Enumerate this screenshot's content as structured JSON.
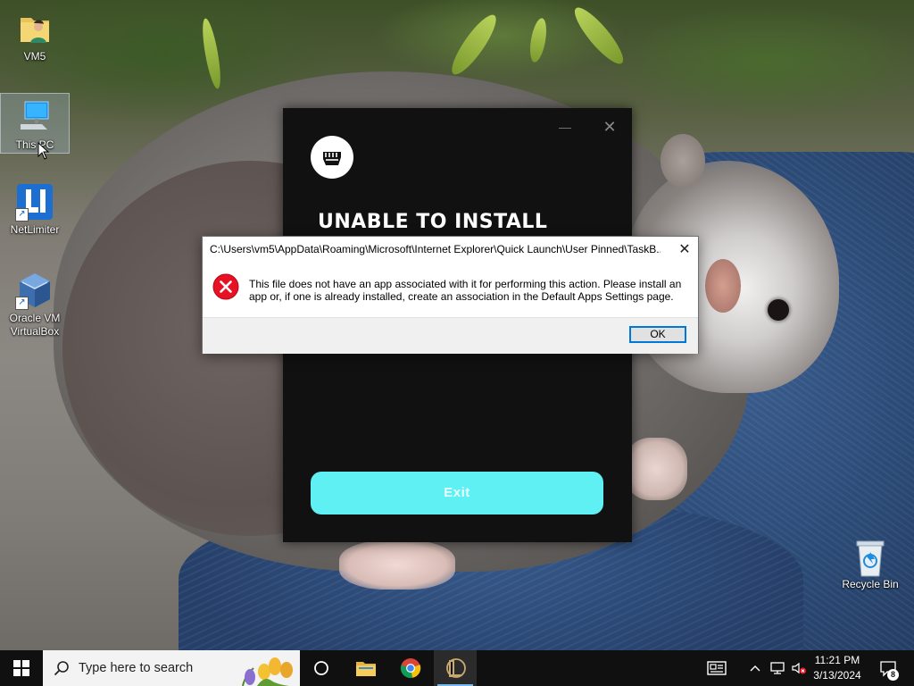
{
  "desktop": {
    "icons": [
      {
        "label": "VM5",
        "icon": "user-folder-icon"
      },
      {
        "label": "This PC",
        "icon": "computer-icon"
      },
      {
        "label": "NetLimiter",
        "icon": "netlimiter-icon"
      },
      {
        "label": "Oracle VM VirtualBox",
        "icon": "virtualbox-icon"
      },
      {
        "label": "Recycle Bin",
        "icon": "recycle-bin-icon"
      }
    ]
  },
  "installer": {
    "heading": "UNABLE TO INSTALL",
    "exit_label": "Exit",
    "minimize_glyph": "—",
    "close_glyph": "✕",
    "logo_icon": "riot-fist-icon",
    "accent_color": "#5ff0f4"
  },
  "dialog": {
    "title": "C:\\Users\\vm5\\AppData\\Roaming\\Microsoft\\Internet Explorer\\Quick Launch\\User Pinned\\TaskB...",
    "message": "This file does not have an app associated with it for performing this action. Please install an app or, if one is already installed, create an association in the Default Apps Settings page.",
    "ok_label": "OK",
    "close_glyph": "✕",
    "icon": "error-icon"
  },
  "taskbar": {
    "search_placeholder": "Type here to search",
    "pinned": [
      "cortana-icon",
      "file-explorer-icon",
      "chrome-icon",
      "league-of-legends-icon"
    ],
    "tray": [
      "news-widget-icon",
      "chevron-up-icon",
      "network-icon",
      "volume-muted-icon"
    ],
    "clock_time": "11:21 PM",
    "clock_date": "3/13/2024",
    "notification_count": "8"
  }
}
